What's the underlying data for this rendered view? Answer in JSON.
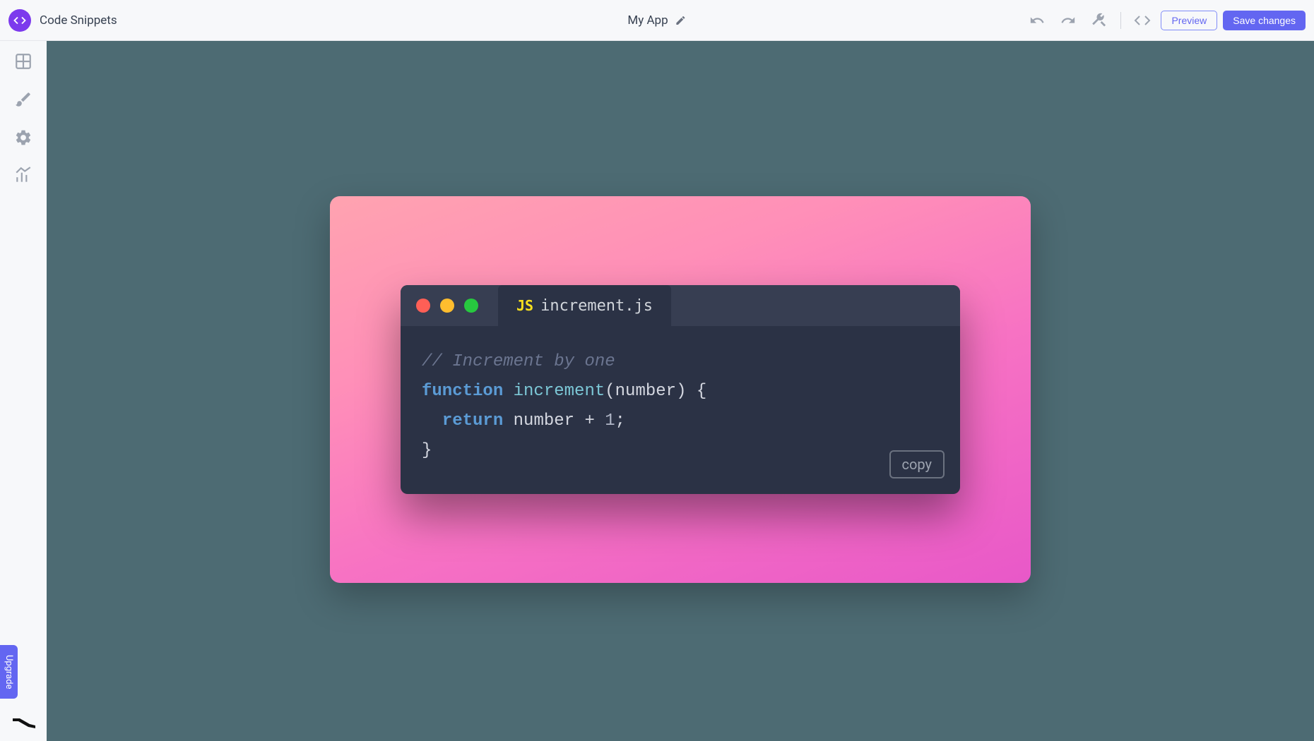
{
  "header": {
    "title": "Code Snippets",
    "app_name": "My App",
    "preview_label": "Preview",
    "save_label": "Save changes"
  },
  "sidebar": {
    "upgrade_label": "Upgrade"
  },
  "snippet": {
    "file_name": "increment.js",
    "js_badge": "JS",
    "copy_label": "copy",
    "code": {
      "comment": "// Increment by one",
      "line2_keyword": "function",
      "line2_fn": "increment",
      "line2_open": "(",
      "line2_param": "number",
      "line2_close": ") {",
      "line3_indent": "  ",
      "line3_keyword": "return",
      "line3_expr_a": " number + ",
      "line3_num": "1",
      "line3_tail": ";",
      "line4": "}"
    }
  }
}
